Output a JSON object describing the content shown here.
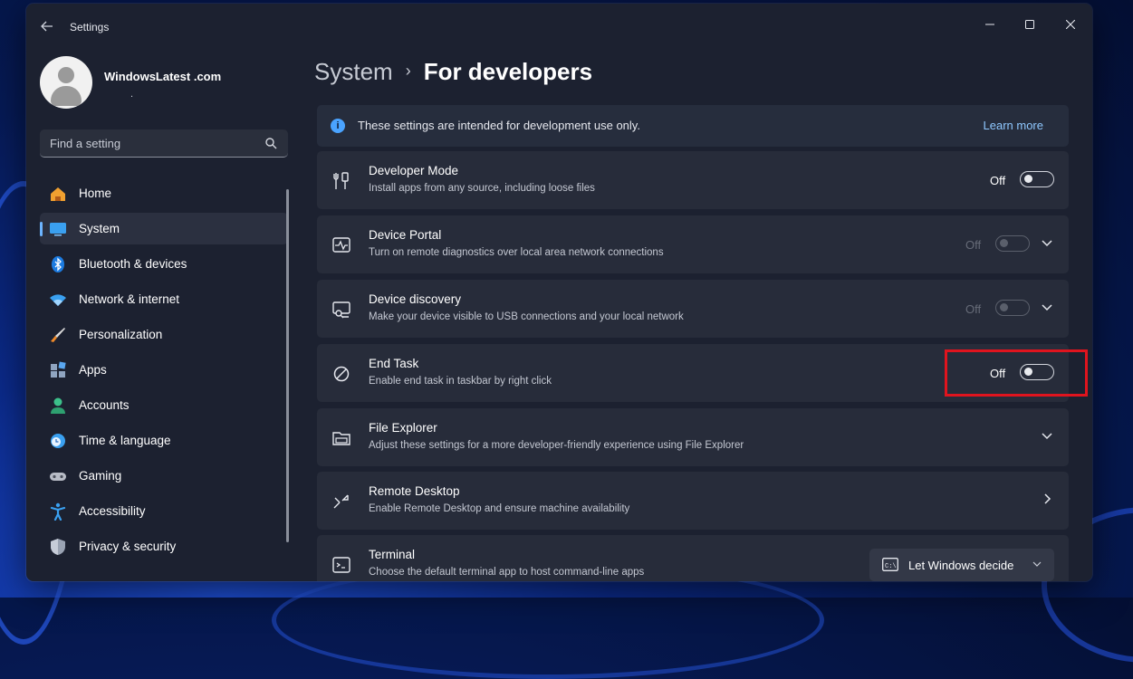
{
  "app": {
    "title": "Settings"
  },
  "profile": {
    "name": "WindowsLatest .com",
    "subtitle": "."
  },
  "search": {
    "placeholder": "Find a setting"
  },
  "sidebar": {
    "items": [
      {
        "label": "Home",
        "icon": "home-icon"
      },
      {
        "label": "System",
        "icon": "system-icon",
        "active": true
      },
      {
        "label": "Bluetooth & devices",
        "icon": "bluetooth-icon"
      },
      {
        "label": "Network & internet",
        "icon": "wifi-icon"
      },
      {
        "label": "Personalization",
        "icon": "brush-icon"
      },
      {
        "label": "Apps",
        "icon": "apps-icon"
      },
      {
        "label": "Accounts",
        "icon": "person-icon"
      },
      {
        "label": "Time & language",
        "icon": "clock-globe-icon"
      },
      {
        "label": "Gaming",
        "icon": "gamepad-icon"
      },
      {
        "label": "Accessibility",
        "icon": "accessibility-icon"
      },
      {
        "label": "Privacy & security",
        "icon": "shield-icon"
      }
    ]
  },
  "breadcrumb": {
    "parent": "System",
    "separator": "›",
    "current": "For developers"
  },
  "info": {
    "text": "These settings are intended for development use only.",
    "link": "Learn more"
  },
  "settings": [
    {
      "title": "Developer Mode",
      "description": "Install apps from any source, including loose files",
      "state": "Off",
      "icon": "tools-icon",
      "control": "toggle",
      "enabled": true
    },
    {
      "title": "Device Portal",
      "description": "Turn on remote diagnostics over local area network connections",
      "state": "Off",
      "icon": "pulse-icon",
      "control": "toggle-expand",
      "enabled": false
    },
    {
      "title": "Device discovery",
      "description": "Make your device visible to USB connections and your local network",
      "state": "Off",
      "icon": "device-search-icon",
      "control": "toggle-expand",
      "enabled": false
    },
    {
      "title": "End Task",
      "description": "Enable end task in taskbar by right click",
      "state": "Off",
      "icon": "block-icon",
      "control": "toggle",
      "enabled": true
    },
    {
      "title": "File Explorer",
      "description": "Adjust these settings for a more developer-friendly experience using File Explorer",
      "icon": "folder-icon",
      "control": "expand"
    },
    {
      "title": "Remote Desktop",
      "description": "Enable Remote Desktop and ensure machine availability",
      "icon": "remote-icon",
      "control": "navigate"
    },
    {
      "title": "Terminal",
      "description": "Choose the default terminal app to host command-line apps",
      "icon": "terminal-icon",
      "control": "dropdown",
      "value": "Let Windows decide"
    }
  ],
  "colors": {
    "accent": "#6cb4ff",
    "highlight_box": "#e0141e",
    "window_bg": "#1c2130",
    "card_bg": "#272c3a"
  }
}
